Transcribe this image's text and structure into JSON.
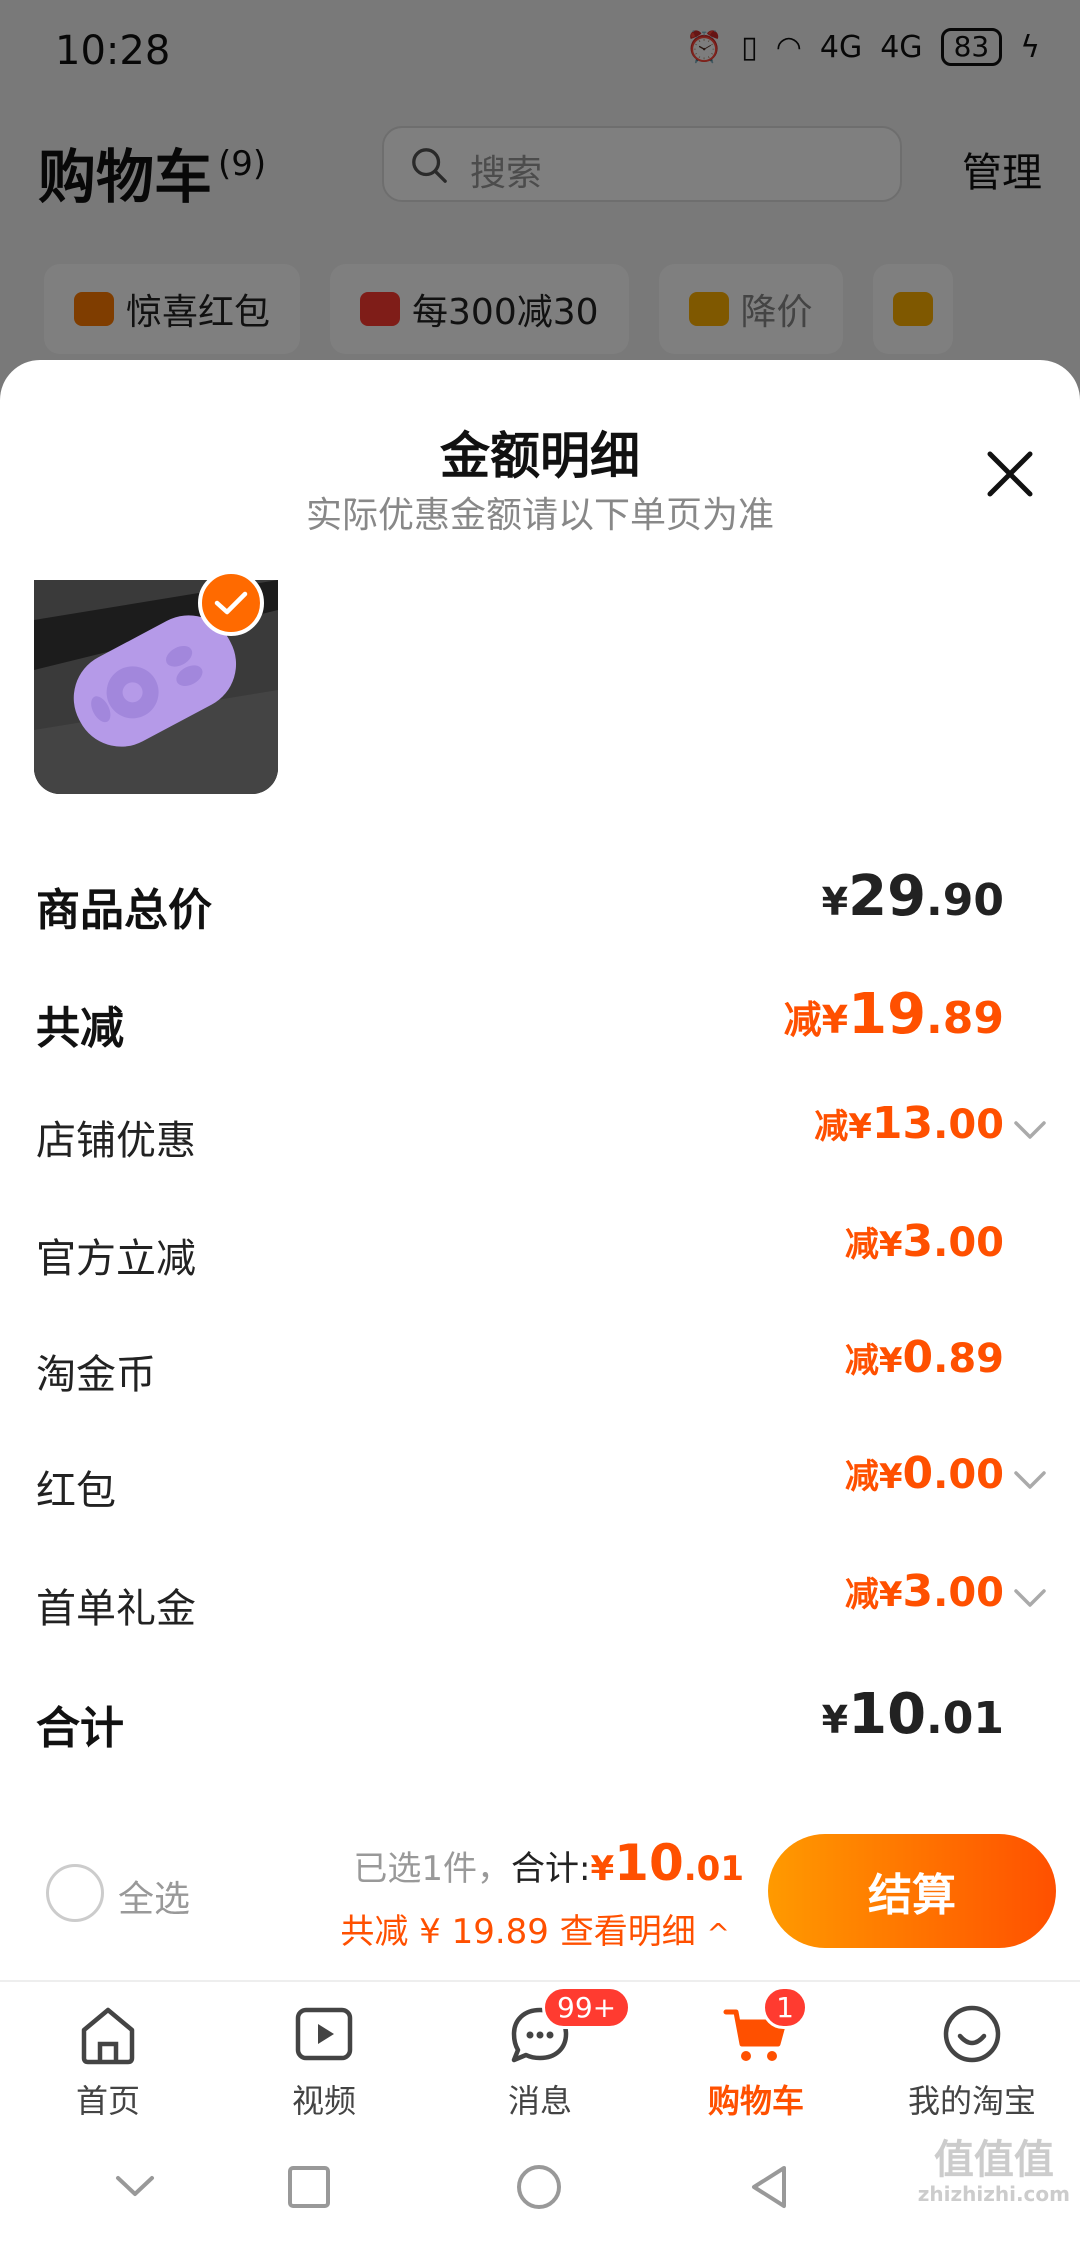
{
  "status_bar": {
    "time": "10:28",
    "battery": "83",
    "network": "4G"
  },
  "cart_header": {
    "title": "购物车",
    "count": "(9)",
    "search_placeholder": "搜索",
    "manage": "管理"
  },
  "chips": [
    {
      "label": "惊喜红包",
      "color": "#ff7a00"
    },
    {
      "label": "每300减30",
      "color": "#ff3b30"
    },
    {
      "label": "降价",
      "color": "#ffb000"
    }
  ],
  "sheet": {
    "title": "金额明细",
    "subtitle": "实际优惠金额请以下单页为准",
    "rows": [
      {
        "label": "商品总价",
        "prefix": "¥",
        "int": "29",
        "dec": ".90"
      },
      {
        "label": "共减",
        "prefix": "减¥",
        "int": "19",
        "dec": ".89"
      },
      {
        "label": "店铺优惠",
        "prefix": "减¥",
        "int": "13",
        "dec": ".00"
      },
      {
        "label": "官方立减",
        "prefix": "减¥",
        "int": "3",
        "dec": ".00"
      },
      {
        "label": "淘金币",
        "prefix": "减¥",
        "int": "0",
        "dec": ".89"
      },
      {
        "label": "红包",
        "prefix": "减¥",
        "int": "0",
        "dec": ".00"
      },
      {
        "label": "首单礼金",
        "prefix": "减¥",
        "int": "3",
        "dec": ".00"
      },
      {
        "label": "合计",
        "prefix": "¥",
        "int": "10",
        "dec": ".01"
      }
    ]
  },
  "checkout": {
    "select_all": "全选",
    "selected": "已选1件，",
    "total_label": "合计:",
    "total_prefix": "¥",
    "total_int": "10",
    "total_dec": ".01",
    "discount_text": "共减 ¥ 19.89  查看明细",
    "caret": "^",
    "button": "结算"
  },
  "tabbar": [
    {
      "label": "首页",
      "icon": "home-icon"
    },
    {
      "label": "视频",
      "icon": "video-icon"
    },
    {
      "label": "消息",
      "icon": "message-icon",
      "badge": "99+"
    },
    {
      "label": "购物车",
      "icon": "cart-icon",
      "badge": "1",
      "active": true
    },
    {
      "label": "我的淘宝",
      "icon": "smile-icon"
    }
  ],
  "watermark": {
    "text": "值值值",
    "url": "zhizhizhi.com"
  },
  "colors": {
    "accent": "#ff5000",
    "accent_start": "#ff9a00",
    "badge": "#ff3b30"
  }
}
